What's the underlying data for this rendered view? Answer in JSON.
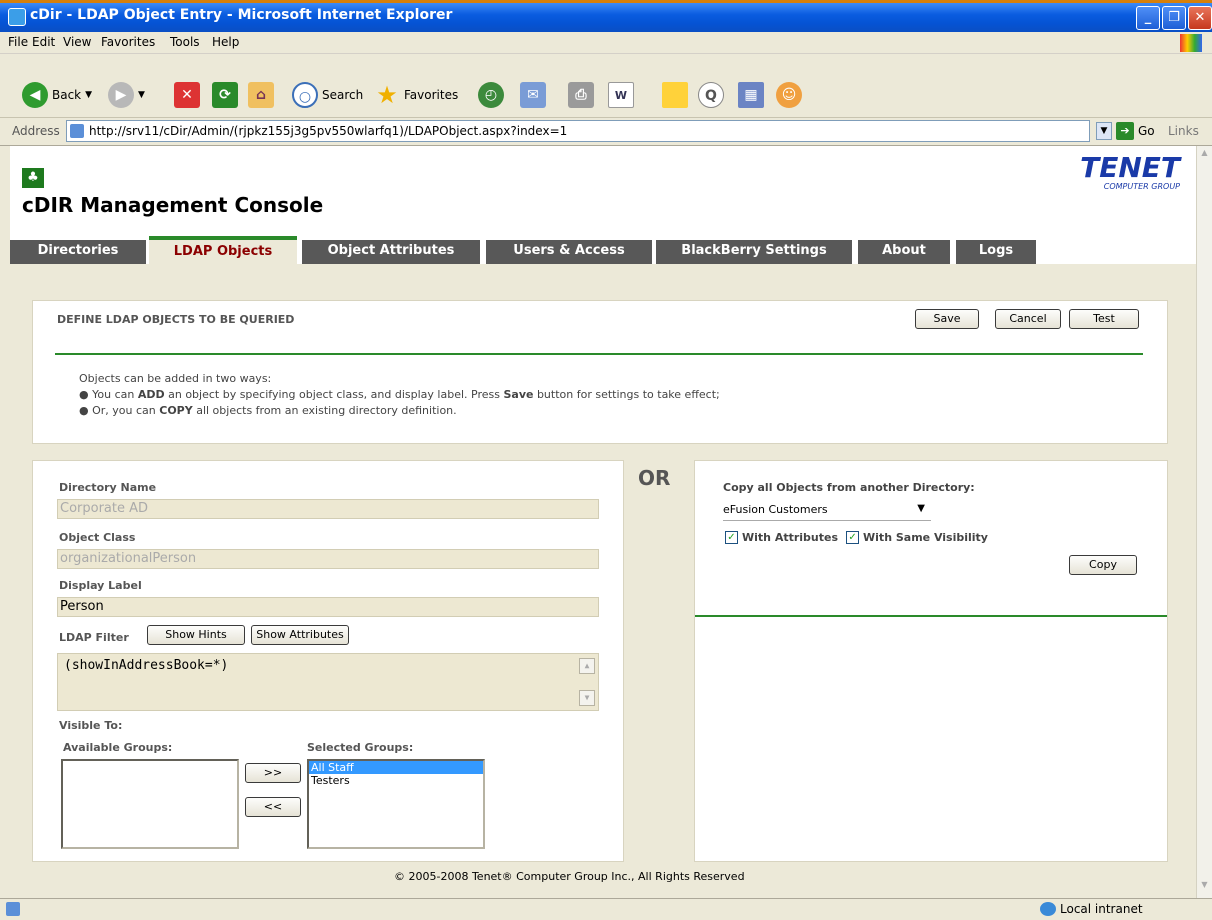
{
  "window": {
    "title": "cDir - LDAP Object Entry - Microsoft Internet Explorer"
  },
  "menubar": {
    "items": [
      "File",
      "Edit",
      "View",
      "Favorites",
      "Tools",
      "Help"
    ]
  },
  "toolbar": {
    "back": "Back",
    "search": "Search",
    "favorites": "Favorites"
  },
  "addressbar": {
    "label": "Address",
    "url": "http://srv11/cDir/Admin/(rjpkz155j3g5pv550wlarfq1)/LDAPObject.aspx?index=1",
    "go": "Go",
    "links": "Links"
  },
  "header": {
    "title": "cDIR Management Console",
    "logo_main": "TENET",
    "logo_sub": "COMPUTER GROUP"
  },
  "tabs": [
    "Directories",
    "LDAP Objects",
    "Object Attributes",
    "Users & Access",
    "BlackBerry Settings",
    "About",
    "Logs"
  ],
  "define": {
    "heading": "DEFINE LDAP OBJECTS TO BE QUERIED",
    "save": "Save",
    "cancel": "Cancel",
    "test": "Test",
    "intro": "Objects can be added in two ways:",
    "b1_pre": "You can ",
    "b1_strong": "ADD",
    "b1_mid": " an object by specifying object class, and display label. Press ",
    "b1_strong2": "Save",
    "b1_post": " button for settings to take effect;",
    "b2_pre": "Or, you can ",
    "b2_strong": "COPY",
    "b2_post": " all objects from an existing directory definition."
  },
  "form": {
    "dir_name_label": "Directory Name",
    "dir_name": "Corporate AD",
    "object_class_label": "Object Class",
    "object_class": "organizationalPerson",
    "display_label_label": "Display Label",
    "display_label": "Person",
    "ldap_filter_label": "LDAP Filter",
    "show_hints": "Show Hints",
    "show_attributes": "Show Attributes",
    "ldap_filter": "(showInAddressBook=*)",
    "visible_to": "Visible To:",
    "available_groups_label": "Available Groups:",
    "available_groups": [],
    "selected_groups_label": "Selected Groups:",
    "selected_groups": [
      "All Staff",
      "Testers"
    ],
    "move_right": ">>",
    "move_left": "<<"
  },
  "or_label": "OR",
  "copy": {
    "label": "Copy all Objects from another Directory:",
    "selected": "eFusion Customers",
    "with_attributes": "With Attributes",
    "with_attributes_checked": true,
    "with_visibility": "With Same Visibility",
    "with_visibility_checked": true,
    "button": "Copy"
  },
  "footer": "© 2005-2008 Tenet® Computer Group Inc., All Rights Reserved",
  "status": {
    "zone": "Local intranet"
  },
  "colors": {
    "tab_dark": "#585858",
    "tab_active_text": "#8b0000",
    "accent_green": "#2a8a2a",
    "xp_blue": "#0553d4"
  }
}
